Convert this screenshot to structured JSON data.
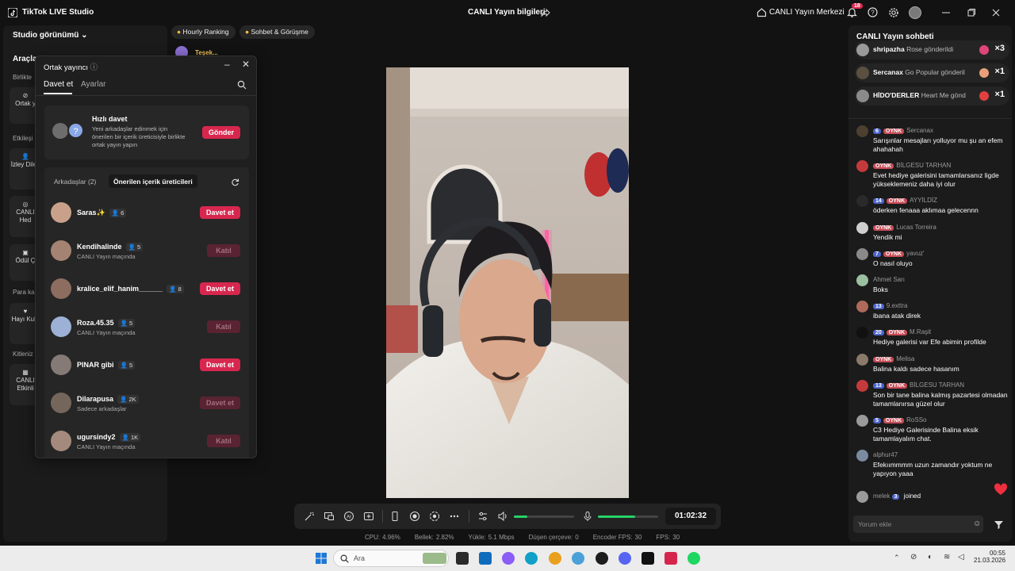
{
  "app": {
    "title": "TikTok LIVE Studio",
    "center_title": "CANLI Yayın bilgileri",
    "live_center": "CANLI Yayın Merkezi",
    "notif_count": "18"
  },
  "studio": {
    "view_label": "Studio görünümü",
    "tools_title": "Araçla",
    "categories": [
      "Birlikte",
      "Etkileşi",
      "Para ka",
      "Kitleniz"
    ],
    "tools": [
      {
        "label": "Ortak y",
        "icon": "link-icon"
      },
      {
        "label": "İzley Dilek",
        "icon": "people-icon"
      },
      {
        "label": "CANLI Hed",
        "icon": "target-icon"
      },
      {
        "label": "Ödül Ç",
        "icon": "gift-box-icon"
      },
      {
        "label": "Hayı Kulü",
        "icon": "heart-icon"
      },
      {
        "label": "CANLI Etkinli",
        "icon": "calendar-icon"
      }
    ]
  },
  "chips": {
    "ranking": "Hourly Ranking",
    "chat": "Sohbet & Görüşme",
    "teşek": "Teşek..."
  },
  "popup": {
    "title": "Ortak yayıncı",
    "tabs": [
      "Davet et",
      "Ayarlar"
    ],
    "quick": {
      "title": "Hızlı davet",
      "desc": "Yeni arkadaşlar edinmek için önerilen bir içerik üreticisiyle birlikte ortak yayın yapın",
      "button": "Gönder"
    },
    "subtabs": [
      "Arkadaşlar (2)",
      "Önerilen içerik üreticileri"
    ],
    "friends": [
      {
        "name": "Saras✨",
        "count": "6",
        "sub": "",
        "action": "Davet et",
        "enabled": true
      },
      {
        "name": "Kendihalinde",
        "count": "5",
        "sub": "CANLI Yayın maçında",
        "action": "Katıl",
        "enabled": false
      },
      {
        "name": "kralice_elif_hanim______",
        "count": "8",
        "sub": "",
        "action": "Davet et",
        "enabled": true
      },
      {
        "name": "Roza.45.35",
        "count": "5",
        "sub": "CANLI Yayın maçında",
        "action": "Katıl",
        "enabled": false
      },
      {
        "name": "PINAR gibi",
        "count": "5",
        "sub": "",
        "action": "Davet et",
        "enabled": true
      },
      {
        "name": "Dilarapusa",
        "count": "2K",
        "sub": "Sadece arkadaşlar",
        "action": "Davet et",
        "enabled": false
      },
      {
        "name": "ugursindy2",
        "count": "1K",
        "sub": "CANLI Yayın maçında",
        "action": "Katıl",
        "enabled": false
      }
    ]
  },
  "controls": {
    "timer": "01:02:32",
    "volume_level": 0.22,
    "mic_level": 0.62
  },
  "stats": [
    {
      "label": "CPU:",
      "value": "4.96%"
    },
    {
      "label": "Bellek:",
      "value": "2.82%"
    },
    {
      "label": "Yükle:",
      "value": "5.1 Mbps"
    },
    {
      "label": "Düşen çerçeve:",
      "value": "0"
    },
    {
      "label": "Encoder FPS:",
      "value": "30"
    },
    {
      "label": "FPS:",
      "value": "30"
    }
  ],
  "chat": {
    "title": "CANLI Yayın sohbeti",
    "gifts": [
      {
        "user": "shripazha",
        "text": "Rose gönderildi",
        "mult": "×3"
      },
      {
        "user": "Sercanax",
        "text": "Go Popular gönderil",
        "mult": "×1"
      },
      {
        "user": "HİDO'DERLER",
        "text": "Heart Me gönd",
        "mult": "×1"
      }
    ],
    "messages": [
      {
        "lv": "6",
        "oynk": "OYNK",
        "user": "Sercanax",
        "text": "Sarışınlar mesajları yolluyor mu şu an efem ahahahah"
      },
      {
        "lv": "",
        "oynk": "OYNK",
        "user": "BİLGESU TARHAN",
        "text": "Evet hediye galerisini tamamlarsanız ligde yükseklemeniz daha iyi olur"
      },
      {
        "lv": "14",
        "oynk": "OYNK",
        "user": "AYYİLDİZ",
        "text": "öderken fenaaa aklımaa gelecennn"
      },
      {
        "lv": "",
        "oynk": "OYNK",
        "user": "Lucas Torreira",
        "text": "Yendik mi"
      },
      {
        "lv": "7",
        "oynk": "OYNK",
        "user": "yavuz'",
        "text": "O nasıl oluyo"
      },
      {
        "lv": "",
        "oynk": "",
        "user": "Ahmet Sarı",
        "text": "Boks"
      },
      {
        "lv": "13",
        "oynk": "",
        "user": "9.exttra",
        "text": "ibana atak direk"
      },
      {
        "lv": "20",
        "oynk": "OYNK",
        "user": "M.Raşit",
        "text": "Hediye galerisi var Efe abimin profilde"
      },
      {
        "lv": "",
        "oynk": "OYNK",
        "user": "Melisa",
        "text": "Balina kaldı sadece hasanım"
      },
      {
        "lv": "13",
        "oynk": "OYNK",
        "user": "BİLGESU TARHAN",
        "text": "Son bir tane balina kalmış pazartesi olmadan tamamlanırsa güzel olur"
      },
      {
        "lv": "5",
        "oynk": "OYNK",
        "user": "RoSSo",
        "text": "C3 Hediye Galerisinde Balina eksik tamamlayalım chat."
      },
      {
        "lv": "",
        "oynk": "",
        "user": "alphur47",
        "text": "Efekıımmmm uzun zamandır yoktum ne yapıyon yaaa"
      }
    ],
    "joined": {
      "user": "melek",
      "lv": "3",
      "text": "joined"
    },
    "input_placeholder": "Yorum ekle"
  },
  "taskbar": {
    "search_placeholder": "Ara",
    "time": "00:55",
    "date": "21.03.2026"
  },
  "colors": {
    "accent": "#d8274f",
    "bg": "#121212",
    "panel": "#1b1b1b",
    "green": "#25d366",
    "level": "#4d65c9"
  }
}
